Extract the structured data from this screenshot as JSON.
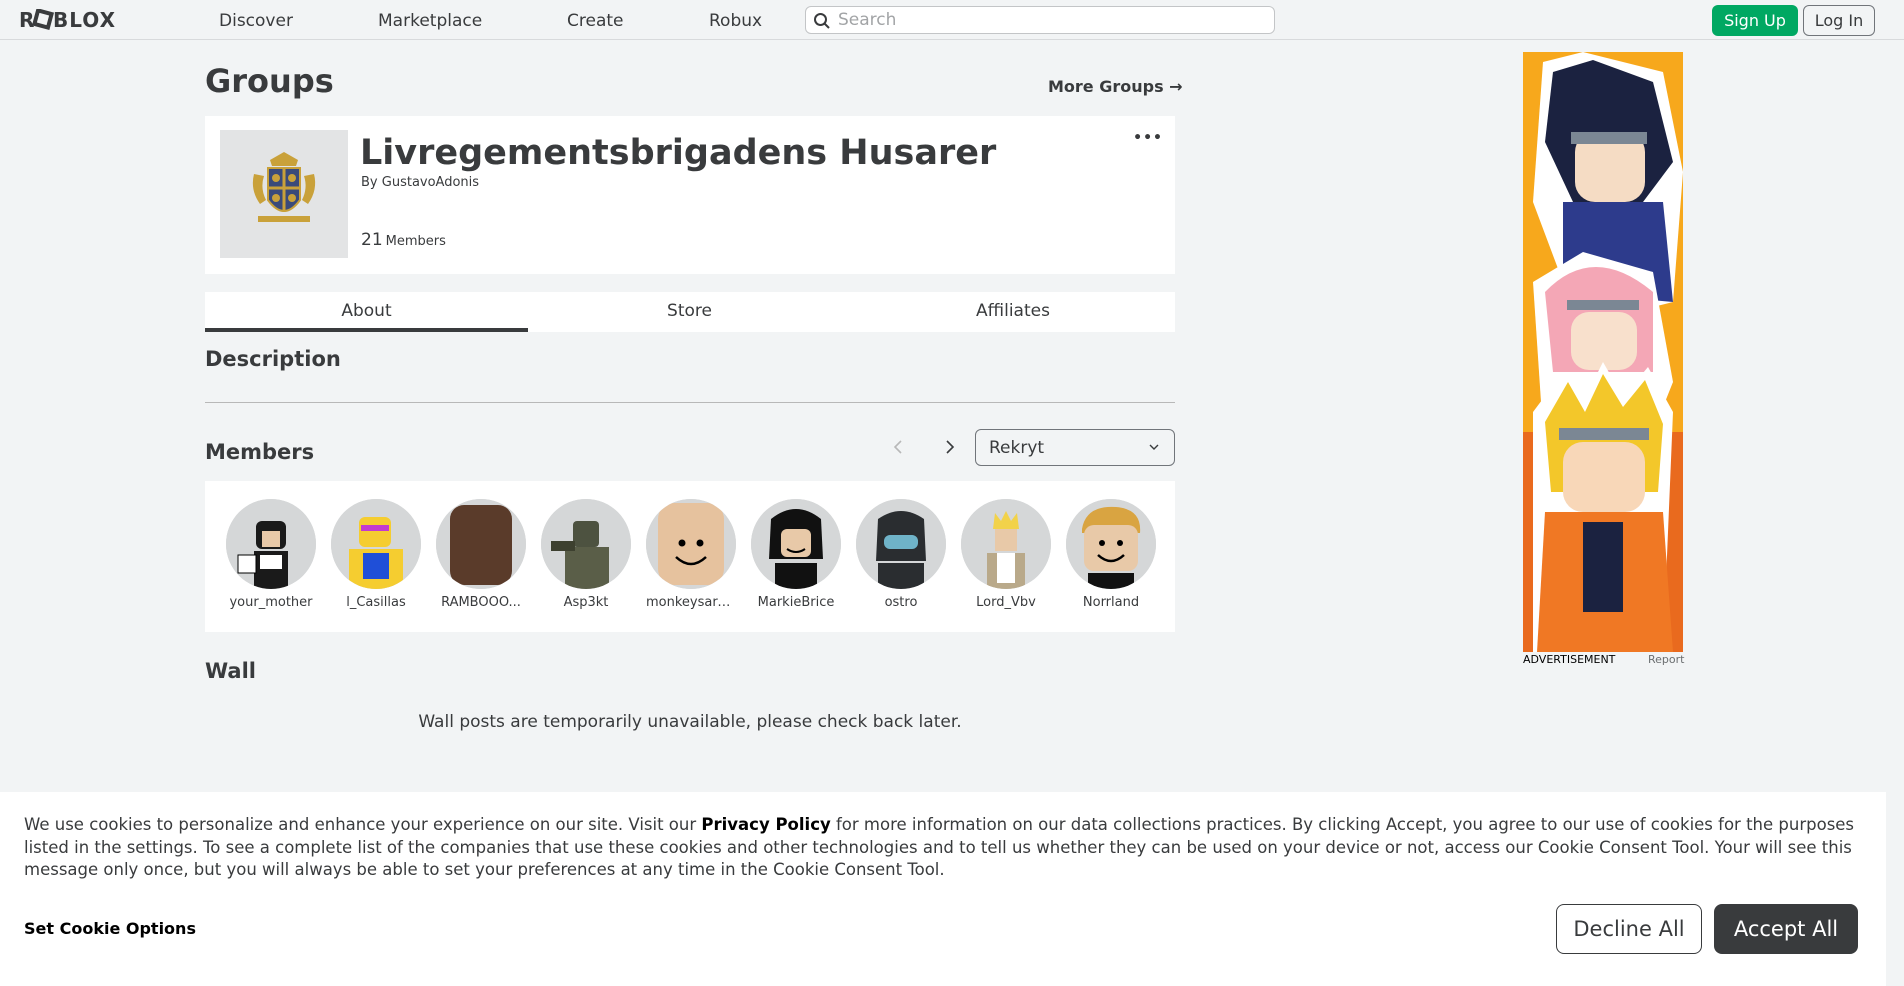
{
  "nav": {
    "logo": "ROBLOX",
    "links": [
      "Discover",
      "Marketplace",
      "Create",
      "Robux"
    ],
    "search_placeholder": "Search",
    "signup": "Sign Up",
    "login": "Log In"
  },
  "page": {
    "title": "Groups",
    "more_groups": "More Groups →"
  },
  "group": {
    "name": "Livregementsbrigadens Husarer",
    "by_prefix": "By",
    "owner": "GustavoAdonis",
    "member_count": "21",
    "member_label": "Members",
    "menu": "•••"
  },
  "tabs": [
    "About",
    "Store",
    "Affiliates"
  ],
  "sections": {
    "description": "Description",
    "members": "Members",
    "wall": "Wall",
    "wall_message": "Wall posts are temporarily unavailable, please check back later."
  },
  "members": {
    "rank_selected": "Rekryt",
    "list": [
      "your_mother",
      "l_Casillas",
      "RAMBOOO...",
      "Asp3kt",
      "monkeysare...",
      "MarkieBrice",
      "ostro",
      "Lord_Vbv",
      "Norrland"
    ]
  },
  "ad": {
    "label": "ADVERTISEMENT",
    "report": "Report"
  },
  "cookie": {
    "text_before": "We use cookies to personalize and enhance your experience on our site. Visit our ",
    "policy_link": "Privacy Policy",
    "text_after": " for more information on our data collections practices. By clicking Accept, you agree to our use of cookies for the purposes listed in the settings. To see a complete list of the companies that use these cookies and other technologies and to tell us whether they can be used on your device or not, access our Cookie Consent Tool. Your will see this message only once, but you will always be able to set your preferences at any time in the Cookie Consent Tool.",
    "set_options": "Set Cookie Options",
    "decline": "Decline All",
    "accept": "Accept All"
  },
  "colors": {
    "signup_green": "#00a862",
    "background": "#f2f4f5",
    "text": "#393b3d",
    "ad_bg": "#f7a81c"
  }
}
